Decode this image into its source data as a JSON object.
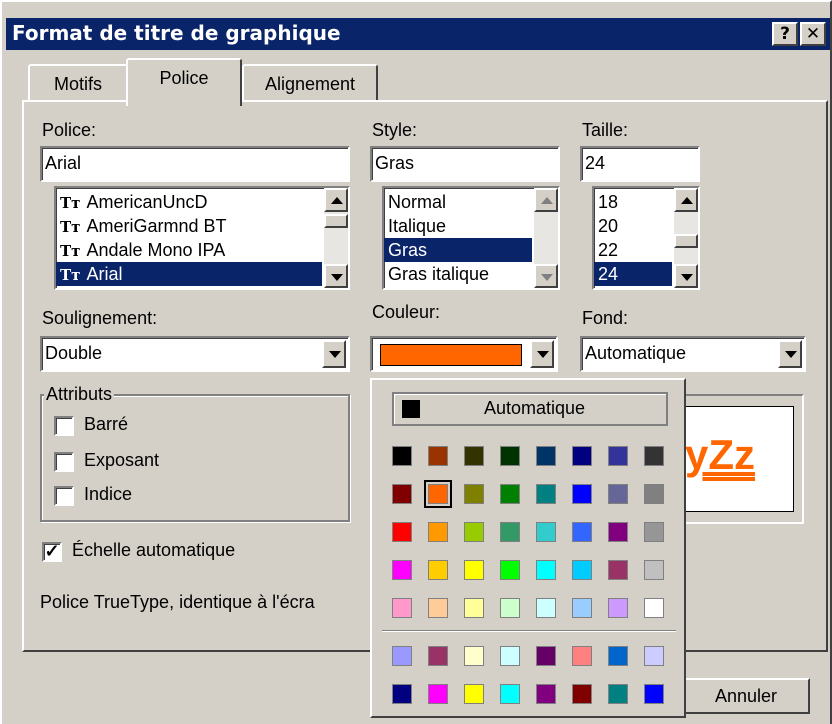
{
  "window": {
    "title": "Format de titre de graphique",
    "help_label": "?",
    "close_label": "✕"
  },
  "tabs": [
    {
      "label": "Motifs"
    },
    {
      "label": "Police"
    },
    {
      "label": "Alignement"
    }
  ],
  "police": {
    "label": "Police:",
    "value": "Arial",
    "items": [
      "AmericanUncD",
      "AmeriGarmnd BT",
      "Andale Mono IPA",
      "Arial"
    ],
    "selected": "Arial",
    "tt_glyph": "Tт"
  },
  "style": {
    "label": "Style:",
    "value": "Gras",
    "items": [
      "Normal",
      "Italique",
      "Gras",
      "Gras italique"
    ],
    "selected": "Gras"
  },
  "taille": {
    "label": "Taille:",
    "value": "24",
    "items": [
      "18",
      "20",
      "22",
      "24"
    ],
    "selected": "24"
  },
  "soulignement": {
    "label": "Soulignement:",
    "value": "Double"
  },
  "couleur": {
    "label": "Couleur:",
    "value_color": "#ff6600"
  },
  "fond": {
    "label": "Fond:",
    "value": "Automatique"
  },
  "attributs": {
    "label": "Attributs",
    "barre": {
      "label": "Barré",
      "checked": false
    },
    "exposant": {
      "label": "Exposant",
      "checked": false
    },
    "indice": {
      "label": "Indice",
      "checked": false
    }
  },
  "echelle": {
    "label": "Échelle automatique",
    "checked": true,
    "check_glyph": "✓"
  },
  "info_text": "Police TrueType, identique à l'écra",
  "preview": {
    "text": "yZz",
    "color": "#ff6600"
  },
  "palette": {
    "auto_label": "Automatique",
    "auto_color": "#000000",
    "selected": "#ff6600",
    "main": [
      [
        "#000000",
        "#993300",
        "#333300",
        "#003300",
        "#003366",
        "#000080",
        "#333399",
        "#333333"
      ],
      [
        "#800000",
        "#ff6600",
        "#808000",
        "#008000",
        "#008080",
        "#0000ff",
        "#666699",
        "#808080"
      ],
      [
        "#ff0000",
        "#ff9900",
        "#99cc00",
        "#339966",
        "#33cccc",
        "#3366ff",
        "#800080",
        "#969696"
      ],
      [
        "#ff00ff",
        "#ffcc00",
        "#ffff00",
        "#00ff00",
        "#00ffff",
        "#00ccff",
        "#993366",
        "#c0c0c0"
      ],
      [
        "#ff99cc",
        "#ffcc99",
        "#ffff99",
        "#ccffcc",
        "#ccffff",
        "#99ccff",
        "#cc99ff",
        "#ffffff"
      ]
    ],
    "extra": [
      [
        "#9999ff",
        "#993366",
        "#ffffcc",
        "#ccffff",
        "#660066",
        "#ff8080",
        "#0066cc",
        "#ccccff"
      ],
      [
        "#000080",
        "#ff00ff",
        "#ffff00",
        "#00ffff",
        "#800080",
        "#800000",
        "#008080",
        "#0000ff"
      ]
    ]
  },
  "buttons": {
    "annuler": "Annuler"
  }
}
